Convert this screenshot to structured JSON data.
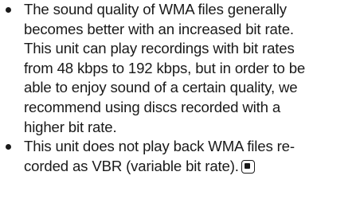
{
  "bullets": [
    {
      "lines": [
        "The sound quality of WMA files generally",
        "becomes better with an increased bit rate.",
        "This unit can play recordings with bit rates",
        "from 48 kbps to 192 kbps, but in order to be",
        "able to enjoy sound of a certain quality, we",
        "recommend using discs recorded with a",
        "higher bit rate."
      ]
    },
    {
      "lines": [
        "This unit does not play back WMA files re-",
        "corded as VBR (variable bit rate)."
      ]
    }
  ],
  "end_mark_icon": "square-end-mark-icon"
}
